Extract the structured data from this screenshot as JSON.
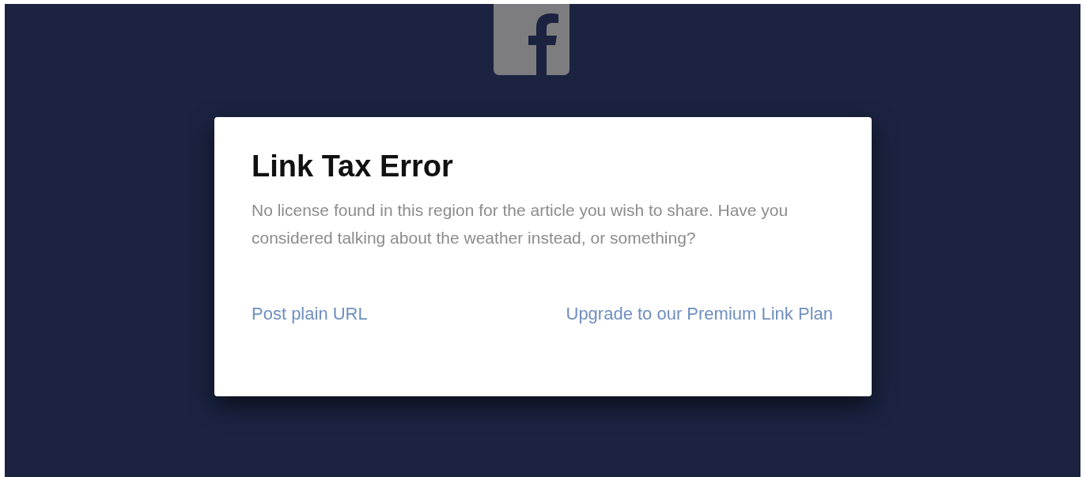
{
  "dialog": {
    "title": "Link Tax Error",
    "message": "No license found in this region for the article you wish to share. Have you considered talking about the weather instead, or something?",
    "actions": [
      {
        "label": "Post plain URL"
      },
      {
        "label": "Upgrade to our Premium Link Plan"
      }
    ]
  }
}
